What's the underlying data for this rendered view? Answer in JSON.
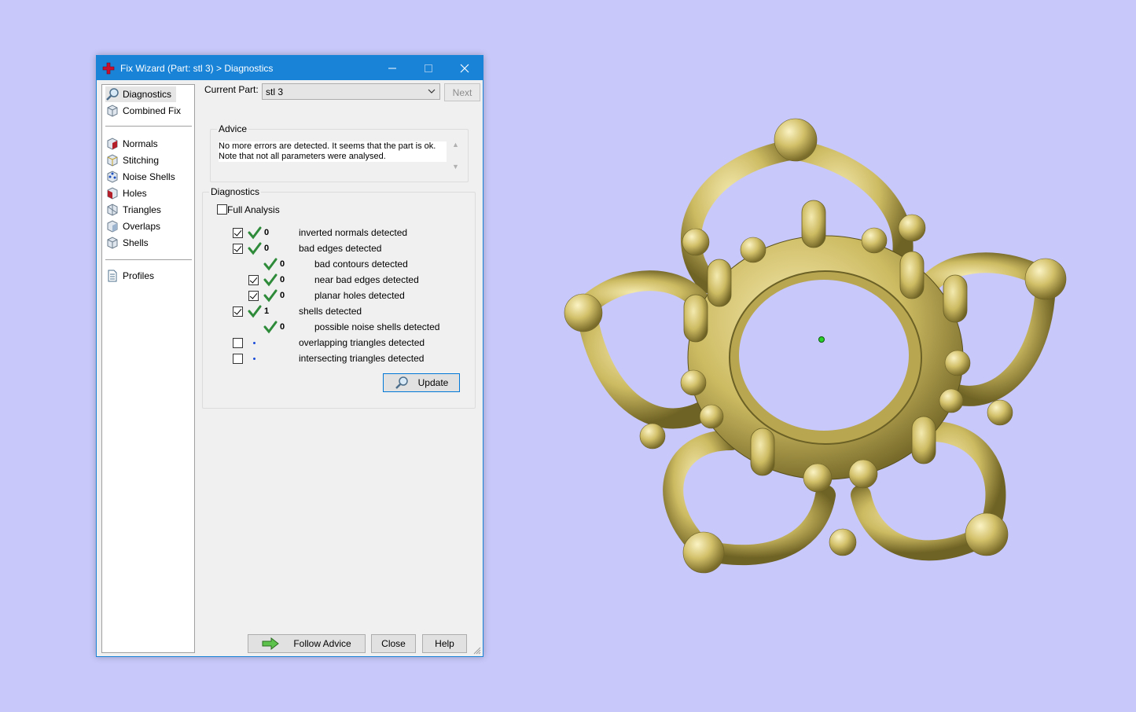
{
  "window": {
    "title": "Fix Wizard (Part: stl 3) > Diagnostics"
  },
  "sidebar": {
    "items": [
      {
        "label": "Diagnostics",
        "icon": "magnifier-icon",
        "selected": true
      },
      {
        "label": "Combined Fix",
        "icon": "cube-icon"
      },
      {
        "label": "Normals",
        "icon": "normals-cube-icon"
      },
      {
        "label": "Stitching",
        "icon": "stitching-cube-icon"
      },
      {
        "label": "Noise Shells",
        "icon": "noise-shells-icon"
      },
      {
        "label": "Holes",
        "icon": "holes-cube-icon"
      },
      {
        "label": "Triangles",
        "icon": "triangles-cube-icon"
      },
      {
        "label": "Overlaps",
        "icon": "overlaps-cube-icon"
      },
      {
        "label": "Shells",
        "icon": "shells-cube-icon"
      },
      {
        "label": "Profiles",
        "icon": "document-icon"
      }
    ]
  },
  "current_part": {
    "label": "Current Part:",
    "value": "stl 3",
    "next_label": "Next"
  },
  "advice": {
    "legend": "Advice",
    "line1": "No more errors are detected. It seems that the part is ok.",
    "line2": "Note that not all parameters were analysed."
  },
  "diagnostics": {
    "legend": "Diagnostics",
    "full_analysis_label": "Full Analysis",
    "full_analysis_checked": false,
    "rows": [
      {
        "checked": true,
        "status": "ok",
        "count": "0",
        "label": "inverted normals detected"
      },
      {
        "checked": true,
        "status": "ok",
        "count": "0",
        "label": "bad edges detected"
      },
      {
        "checked": null,
        "status": "ok",
        "count": "0",
        "label": "bad contours detected"
      },
      {
        "checked": true,
        "status": "ok",
        "count": "0",
        "label": "near bad edges detected"
      },
      {
        "checked": true,
        "status": "ok",
        "count": "0",
        "label": "planar holes detected"
      },
      {
        "checked": true,
        "status": "ok",
        "count": "1",
        "label": "shells detected"
      },
      {
        "checked": null,
        "status": "ok",
        "count": "0",
        "label": "possible noise shells detected"
      },
      {
        "checked": false,
        "status": "pending",
        "count": "",
        "label": "overlapping triangles detected"
      },
      {
        "checked": false,
        "status": "pending",
        "count": "",
        "label": "intersecting triangles detected"
      }
    ],
    "update_label": "Update"
  },
  "footer": {
    "follow_advice_label": "Follow Advice",
    "close_label": "Close",
    "help_label": "Help"
  },
  "colors": {
    "viewport_background": "#c8c8fa",
    "titlebar": "#1883d7",
    "model_gold": "#c9b75a",
    "check_green": "#2e8b3a"
  }
}
